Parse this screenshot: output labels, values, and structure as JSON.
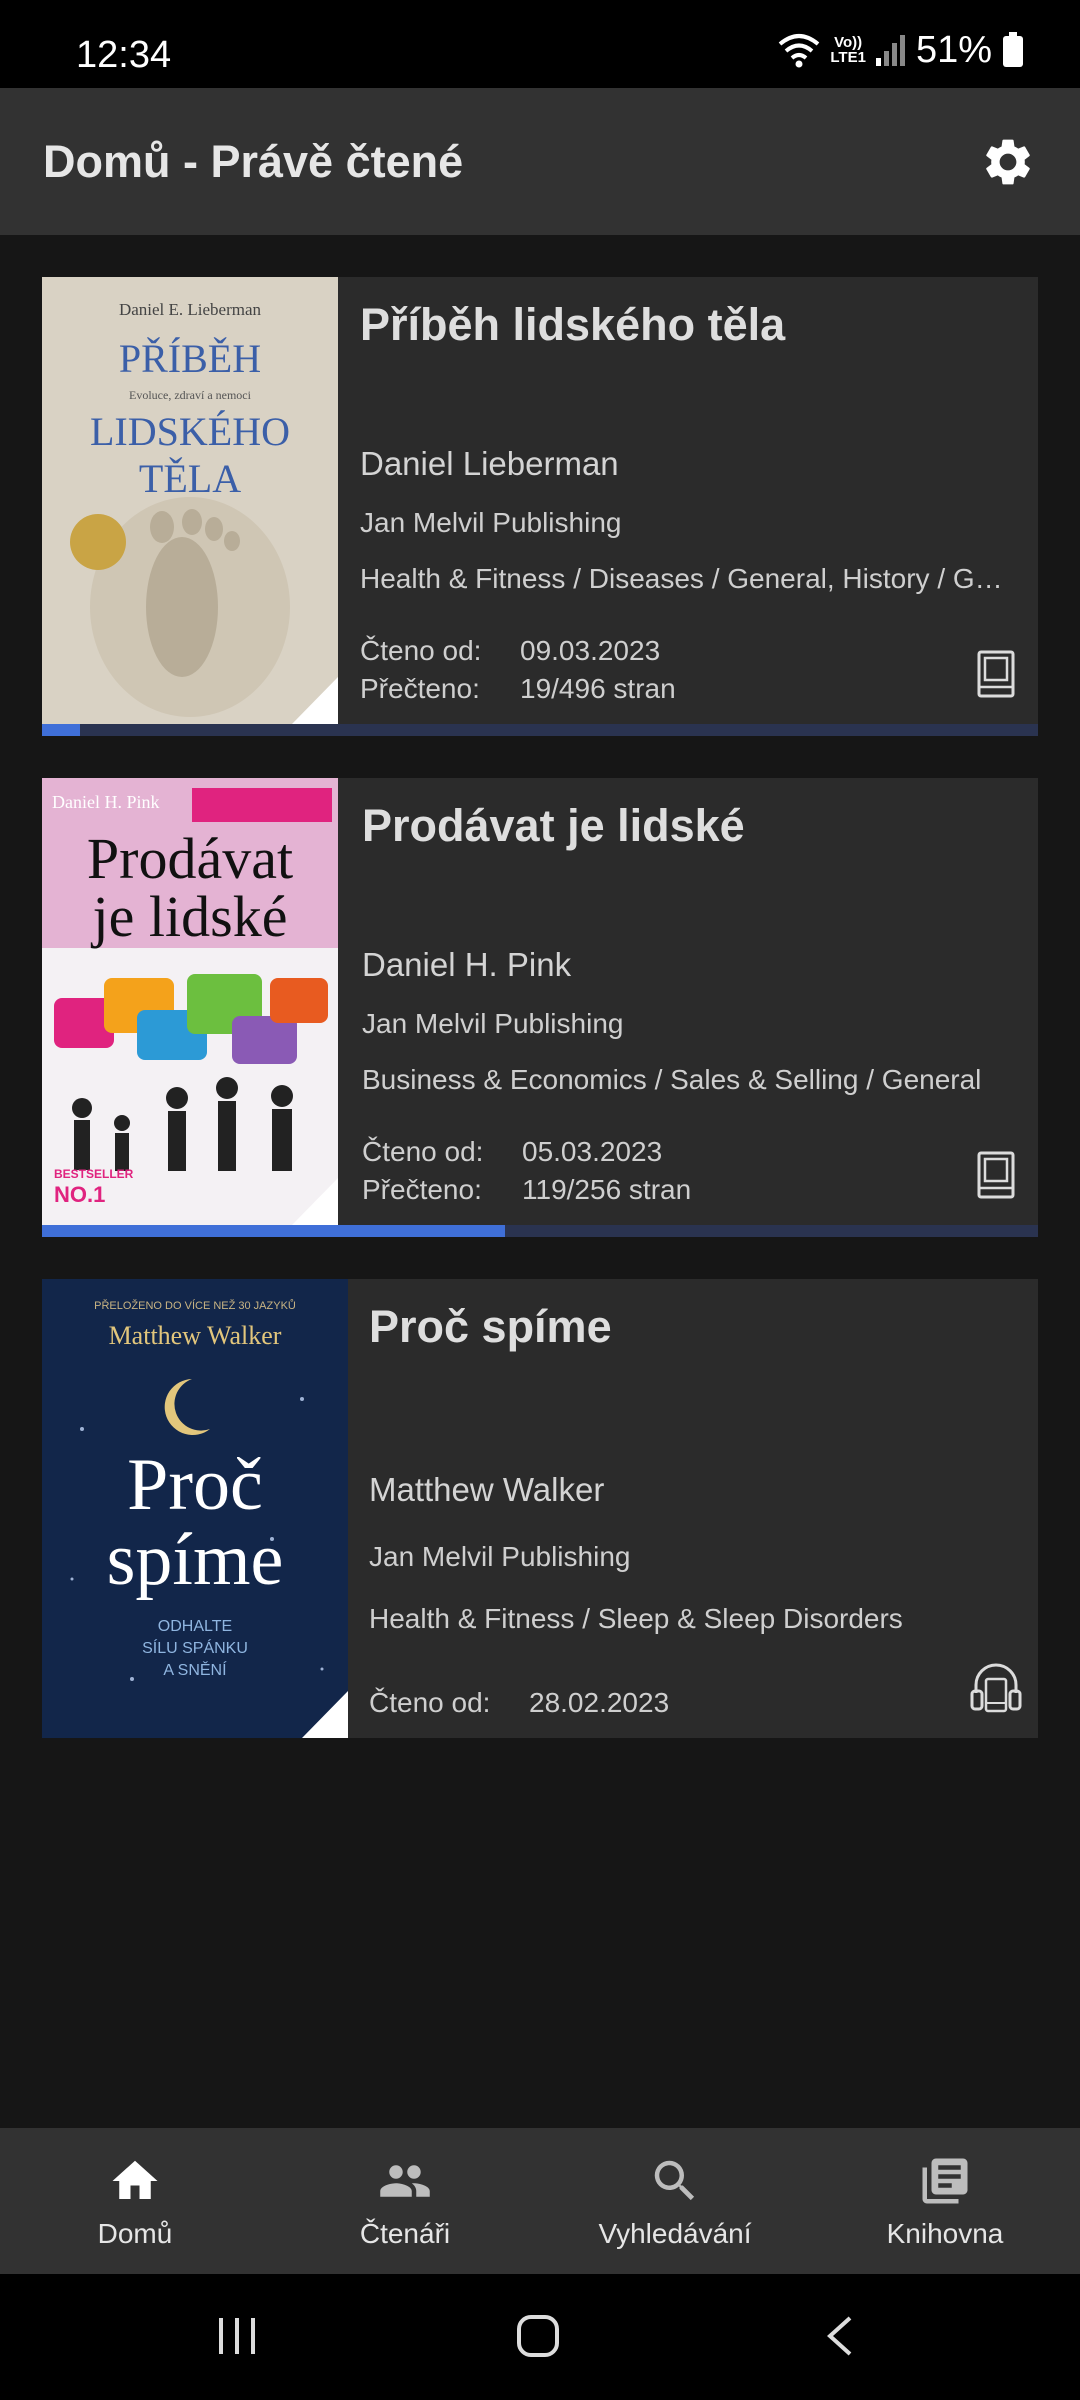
{
  "status_bar": {
    "time": "12:34",
    "network_line1": "Vo))",
    "network_line2": "LTE1",
    "battery": "51%"
  },
  "app_bar": {
    "title": "Domů - Právě čtené",
    "settings_icon": "gear-icon"
  },
  "books": [
    {
      "title": "Příběh lidského těla",
      "author": "Daniel Lieberman",
      "publisher": "Jan Melvil Publishing",
      "categories": "Health & Fitness / Diseases / General, History / General",
      "read_since_label": "Čteno od:",
      "read_since": "09.03.2023",
      "read_label": "Přečteno:",
      "read": "19/496 stran",
      "format_icon": "book-icon",
      "progress": 0.038,
      "cover": {
        "author": "Daniel E. Lieberman",
        "line1": "PŘÍBĚH",
        "subtitle": "Evoluce, zdraví a nemoci",
        "line2": "LIDSKÉHO",
        "line3": "TĚLA"
      }
    },
    {
      "title": "Prodávat je lidské",
      "author": "Daniel H. Pink",
      "publisher": "Jan Melvil Publishing",
      "categories": "Business & Economics / Sales & Selling / General",
      "read_since_label": "Čteno od:",
      "read_since": "05.03.2023",
      "read_label": "Přečteno:",
      "read": "119/256 stran",
      "format_icon": "book-icon",
      "progress": 0.465,
      "cover": {
        "author": "Daniel H. Pink",
        "line1": "Prodávat",
        "line2": "je lidské",
        "badge_top": "BESTSELLER",
        "badge": "NO.1"
      }
    },
    {
      "title": "Proč spíme",
      "author": "Matthew Walker",
      "publisher": "Jan Melvil Publishing",
      "categories": "Health & Fitness / Sleep & Sleep Disorders",
      "read_since_label": "Čteno od:",
      "read_since": "28.02.2023",
      "format_icon": "headphones-icon",
      "cover": {
        "top": "PŘELOŽENO DO VÍCE NEŽ 30 JAZYKŮ",
        "author": "Matthew Walker",
        "line1": "Proč",
        "line2": "spíme",
        "sub1": "ODHALTE",
        "sub2": "SÍLU SPÁNKU",
        "sub3": "A SNĚNÍ"
      }
    }
  ],
  "bottom_nav": [
    {
      "label": "Domů",
      "icon": "home-icon"
    },
    {
      "label": "Čtenáři",
      "icon": "people-icon"
    },
    {
      "label": "Vyhledávání",
      "icon": "search-icon"
    },
    {
      "label": "Knihovna",
      "icon": "library-icon"
    }
  ],
  "colors": {
    "accent": "#3f6fd8",
    "card": "#2b2b2b",
    "appbar": "#323232",
    "background": "#161616"
  }
}
